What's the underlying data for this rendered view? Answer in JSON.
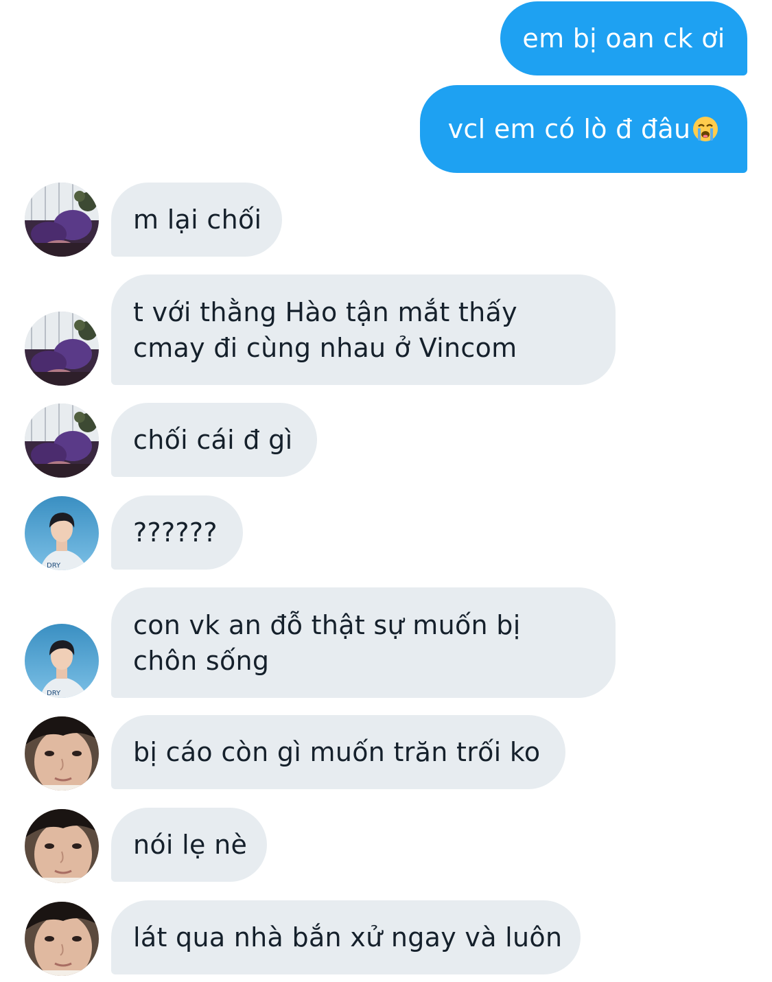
{
  "conversation": {
    "messages": [
      {
        "direction": "outgoing",
        "text": "em bị oan ck ơi"
      },
      {
        "direction": "outgoing",
        "text": "vcl em có lò đ đâu",
        "emoji": "loudly-crying-face-emoji"
      },
      {
        "direction": "incoming",
        "sender_avatar": "avatar-purple-room",
        "text": "m lại chối"
      },
      {
        "direction": "incoming",
        "sender_avatar": "avatar-purple-room",
        "lines": [
          "t với thằng Hào tận mắt thấy",
          "cmay đi cùng nhau ở Vincom"
        ]
      },
      {
        "direction": "incoming",
        "sender_avatar": "avatar-purple-room",
        "text": "chối cái đ gì"
      },
      {
        "direction": "incoming",
        "sender_avatar": "avatar-boy-blue-sky",
        "text": "??????"
      },
      {
        "direction": "incoming",
        "sender_avatar": "avatar-boy-blue-sky",
        "lines": [
          "con vk an đỗ thật sự muốn bị",
          "chôn sống"
        ]
      },
      {
        "direction": "incoming",
        "sender_avatar": "avatar-face-closeup",
        "text": "bị cáo còn gì muốn trăn trối ko"
      },
      {
        "direction": "incoming",
        "sender_avatar": "avatar-face-closeup",
        "text": "nói lẹ nè"
      },
      {
        "direction": "incoming",
        "sender_avatar": "avatar-face-closeup",
        "text": "lát qua nhà bắn xử ngay và luôn"
      }
    ]
  },
  "colors": {
    "outgoing_bubble": "#1ea1f2",
    "incoming_bubble": "#e7ecf0",
    "incoming_text": "#15202b",
    "outgoing_text": "#ffffff"
  }
}
